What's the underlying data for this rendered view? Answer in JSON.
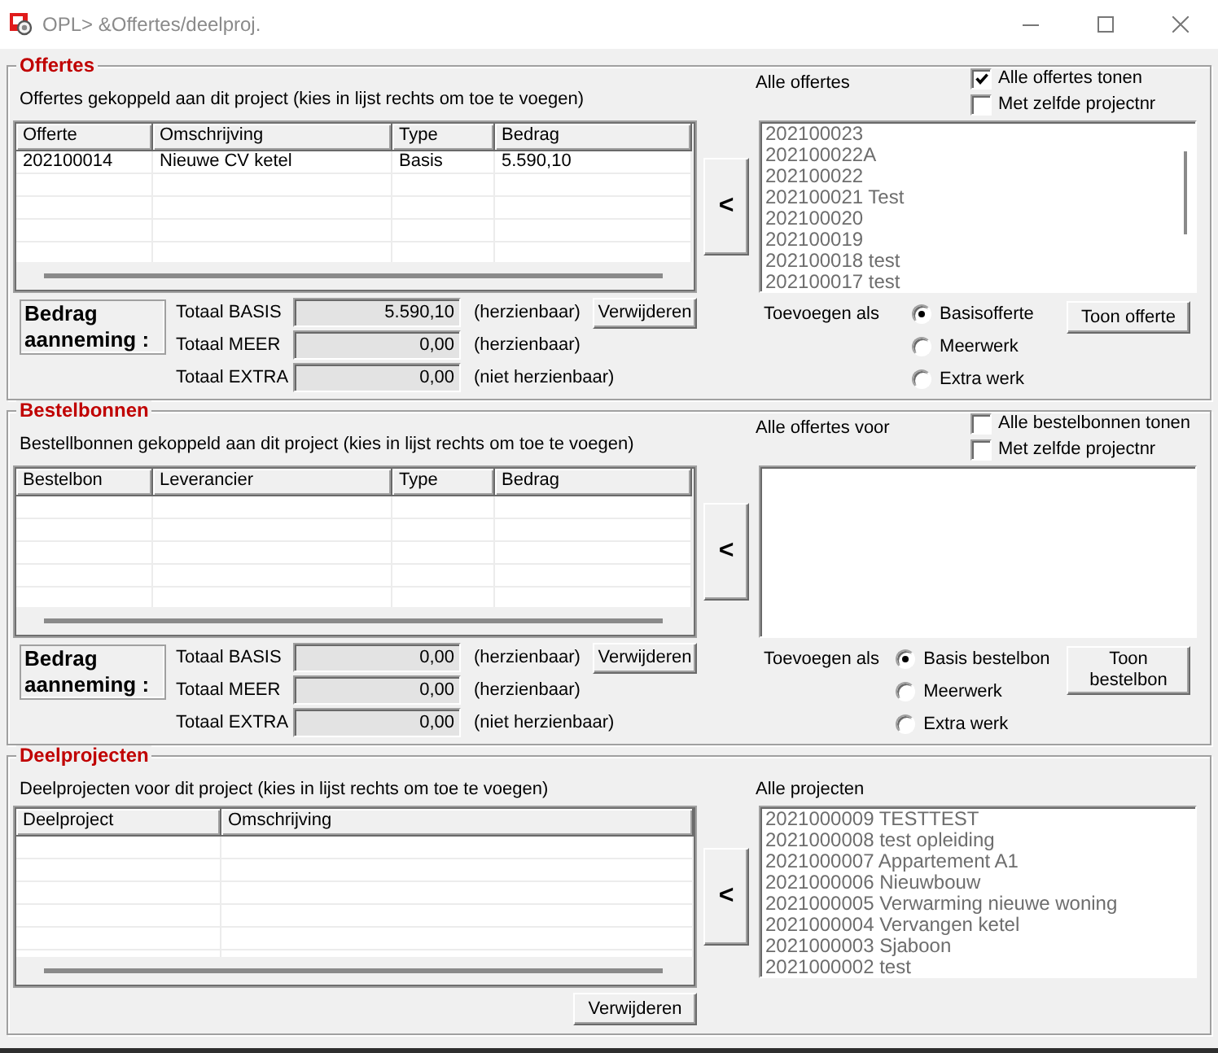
{
  "window": {
    "title": "OPL> &Offertes/deelproj."
  },
  "sections": [
    {
      "title": "Offertes",
      "description": "Offertes gekoppeld aan dit project (kies in lijst rechts om toe te voegen)",
      "list": {
        "label": "Alle offertes",
        "scrollable": true,
        "items": [
          "202100023",
          "202100022A",
          "202100022",
          "202100021 Test",
          "202100020",
          "202100019",
          "202100018 test",
          "202100017 test"
        ]
      },
      "options": [
        {
          "label": "Alle offertes tonen",
          "checked": true
        },
        {
          "label": "Met zelfde projectnr",
          "checked": false
        }
      ],
      "table": {
        "columns": [
          "Offerte",
          "Omschrijving",
          "Type",
          "Bedrag"
        ],
        "rows": [
          [
            "202100014",
            "Nieuwe CV ketel",
            "Basis",
            "5.590,10"
          ]
        ]
      },
      "add_button": "<",
      "summary_label": "Bedrag aanneming :",
      "totals": [
        {
          "label": "Totaal BASIS",
          "value": "5.590,10",
          "note": "(herzienbaar)",
          "readonly": true
        },
        {
          "label": "Totaal MEER",
          "value": "0,00",
          "note": "(herzienbaar)",
          "readonly": true
        },
        {
          "label": "Totaal EXTRA",
          "value": "0,00",
          "note": "(niet herzienbaar)",
          "readonly": true
        }
      ],
      "remove_button": "Verwijderen",
      "add_as": {
        "label": "Toevoegen als",
        "options": [
          {
            "label": "Basisofferte",
            "selected": true
          },
          {
            "label": "Meerwerk",
            "selected": false
          },
          {
            "label": "Extra werk",
            "selected": false
          }
        ]
      },
      "show_button": "Toon offerte"
    },
    {
      "title": "Bestelbonnen",
      "description": "Bestellbonnen gekoppeld aan dit project (kies in lijst rechts om toe te voegen)",
      "list": {
        "label": "Alle offertes voor"
      },
      "options": [
        {
          "label": "Alle bestelbonnen tonen",
          "checked": false
        },
        {
          "label": "Met zelfde projectnr",
          "checked": false
        }
      ],
      "table": {
        "columns": [
          "Bestelbon",
          "Leverancier",
          "Type",
          "Bedrag"
        ]
      },
      "add_button": "<",
      "summary_label": "Bedrag aanneming :",
      "totals": [
        {
          "label": "Totaal BASIS",
          "value": "0,00",
          "note": "(herzienbaar)",
          "readonly": true
        },
        {
          "label": "Totaal MEER",
          "value": "0,00",
          "note": "(herzienbaar)",
          "readonly": true
        },
        {
          "label": "Totaal EXTRA",
          "value": "0,00",
          "note": "(niet herzienbaar)",
          "readonly": true
        }
      ],
      "remove_button": "Verwijderen",
      "add_as": {
        "label": "Toevoegen als",
        "options": [
          {
            "label": "Basis bestelbon",
            "selected": true
          },
          {
            "label": "Meerwerk",
            "selected": false
          },
          {
            "label": "Extra werk",
            "selected": false
          }
        ]
      },
      "show_button": "Toon bestelbon"
    },
    {
      "title": "Deelprojecten",
      "description": "Deelprojecten voor dit project (kies in lijst rechts om toe te voegen)",
      "list": {
        "label": "Alle projecten",
        "items": [
          "2021000009 TESTTEST",
          "2021000008 test opleiding",
          "2021000007 Appartement A1",
          "2021000006 Nieuwbouw",
          "2021000005 Verwarming nieuwe woning",
          "2021000004 Vervangen ketel",
          "2021000003 Sjaboon",
          "2021000002 test"
        ]
      },
      "table": {
        "columns": [
          "Deelproject",
          "Omschrijving"
        ]
      },
      "add_button": "<",
      "remove_button": "Verwijderen"
    }
  ]
}
